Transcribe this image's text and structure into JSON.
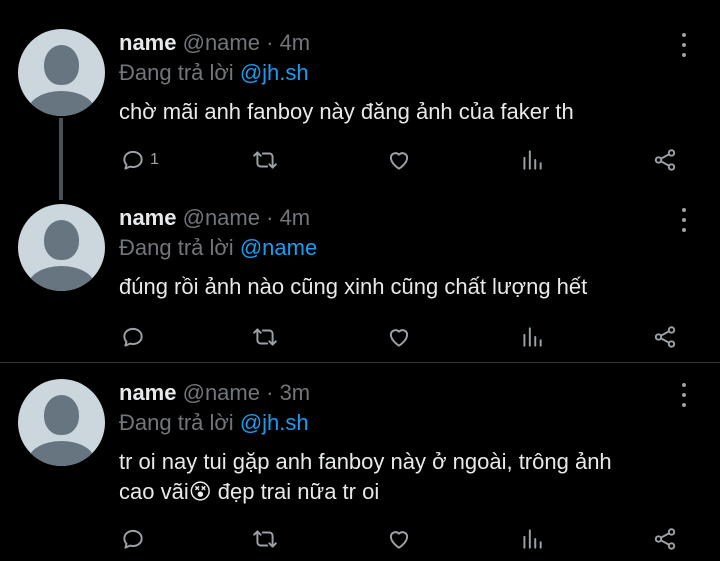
{
  "tweets": [
    {
      "name": "name",
      "handle": "@name",
      "dot": "·",
      "time": "4m",
      "reply_prefix": "Đang trả lời",
      "reply_mention": "@jh.sh",
      "text": "chờ mãi anh fanboy này đăng ảnh của faker th",
      "reply_count": "1"
    },
    {
      "name": "name",
      "handle": "@name",
      "dot": "·",
      "time": "4m",
      "reply_prefix": "Đang trả lời",
      "reply_mention": "@name",
      "text": "đúng rồi ảnh nào cũng xinh cũng chất lượng hết",
      "reply_count": ""
    },
    {
      "name": "name",
      "handle": "@name",
      "dot": "·",
      "time": "3m",
      "reply_prefix": "Đang trả lời",
      "reply_mention": "@jh.sh",
      "text_line1": "tr oi nay tui gặp anh fanboy này ở ngoài, trông ảnh",
      "text_line2": "cao vãi😵 đẹp trai nữa tr oi",
      "reply_count": ""
    }
  ],
  "colors": {
    "background": "#000000",
    "text": "#e7e9ea",
    "muted": "#71767b",
    "link": "#1d9bf0",
    "icon": "#9ba1a6"
  },
  "icons": {
    "reply": "reply-icon",
    "retweet": "retweet-icon",
    "like": "heart-icon",
    "views": "bar-chart-icon",
    "share": "share-icon",
    "more": "more-vertical-icon"
  }
}
